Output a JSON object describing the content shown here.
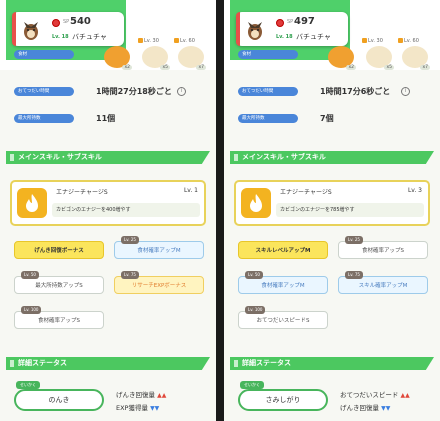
{
  "panels": [
    {
      "strength_label": "SP",
      "strength": "540",
      "level": "Lv. 18",
      "pokemon_name": "バチュチャ",
      "ingredients_label": "食材",
      "ingredient_slots": [
        {
          "level": "",
          "qty": "x2"
        },
        {
          "level": "Lv. 30",
          "qty": "x5"
        },
        {
          "level": "Lv. 60",
          "qty": "x7"
        }
      ],
      "help_time_label": "おてつだい時間",
      "help_time": "1時間27分18秒ごと",
      "max_carry_label": "最大所持数",
      "max_carry": "11個",
      "skills_header": "メインスキル・サブスキル",
      "main_skill": {
        "name": "エナジーチャージS",
        "level": "Lv. 1",
        "desc": "カビゴンのエナジーを400増やす"
      },
      "subskills": [
        {
          "label": "げんき回復ボーナス",
          "badge": "",
          "style": "gold"
        },
        {
          "label": "食材確率アップM",
          "badge": "Lv. 25",
          "style": "blue"
        },
        {
          "label": "最大所持数アップS",
          "badge": "Lv. 50",
          "style": "plain"
        },
        {
          "label": "リサーチEXPボーナス",
          "badge": "Lv. 75",
          "style": "yellow"
        },
        {
          "label": "食材確率アップS",
          "badge": "Lv. 100",
          "style": "plain"
        }
      ],
      "stats_header": "詳細ステータス",
      "nature_badge": "せいかく",
      "nature": "のんき",
      "effect_up": "げんき回復量",
      "effect_down": "EXP獲得量"
    },
    {
      "strength_label": "SP",
      "strength": "497",
      "level": "Lv. 18",
      "pokemon_name": "バチュチャ",
      "ingredients_label": "食材",
      "ingredient_slots": [
        {
          "level": "",
          "qty": "x2"
        },
        {
          "level": "Lv. 30",
          "qty": "x5"
        },
        {
          "level": "Lv. 60",
          "qty": "x7"
        }
      ],
      "help_time_label": "おてつだい時間",
      "help_time": "1時間17分6秒ごと",
      "max_carry_label": "最大所持数",
      "max_carry": "7個",
      "skills_header": "メインスキル・サブスキル",
      "main_skill": {
        "name": "エナジーチャージS",
        "level": "Lv. 3",
        "desc": "カビゴンのエナジーを785増やす"
      },
      "subskills": [
        {
          "label": "スキルレベルアップM",
          "badge": "",
          "style": "gold"
        },
        {
          "label": "食材確率アップS",
          "badge": "Lv. 25",
          "style": "plain"
        },
        {
          "label": "食材確率アップM",
          "badge": "Lv. 50",
          "style": "blue"
        },
        {
          "label": "スキル確率アップM",
          "badge": "Lv. 75",
          "style": "blue"
        },
        {
          "label": "おてつだいスピードS",
          "badge": "Lv. 100",
          "style": "plain"
        }
      ],
      "stats_header": "詳細ステータス",
      "nature_badge": "せいかく",
      "nature": "さみしがり",
      "effect_up": "おてつだいスピード",
      "effect_down": "げんき回復量"
    }
  ],
  "colors": {
    "accent_green": "#4cc860",
    "pill_blue": "#4a86d9",
    "gold": "#fbe55c",
    "divider": "#1a1a1a"
  },
  "icons": {
    "info": "i",
    "up": "▲▲",
    "down": "▼▼"
  }
}
